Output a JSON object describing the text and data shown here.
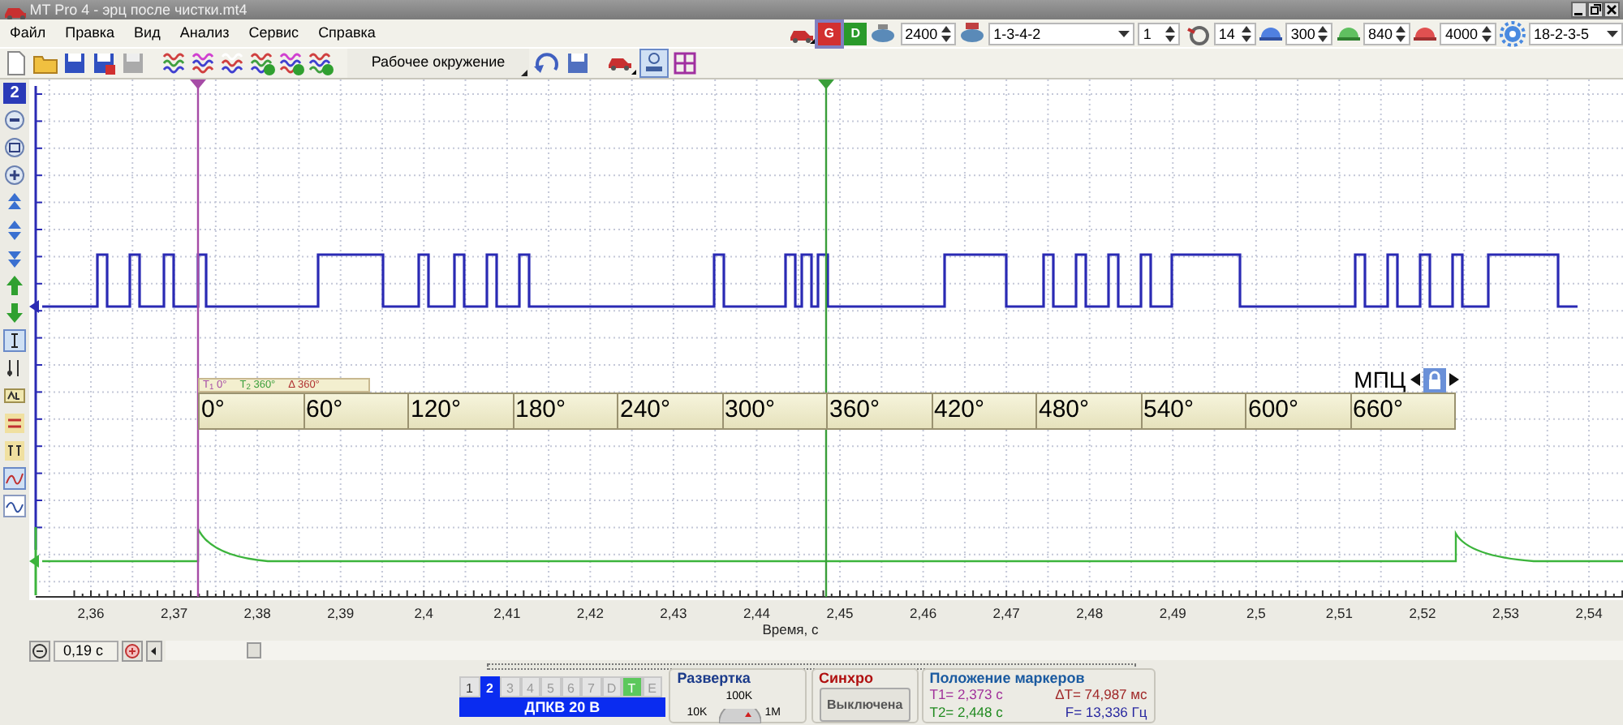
{
  "window": {
    "title": "MT Pro 4 - эрц после чистки.mt4"
  },
  "menu": [
    "Файл",
    "Правка",
    "Вид",
    "Анализ",
    "Сервис",
    "Справка"
  ],
  "engine_bar": {
    "modes": [
      {
        "label": "G",
        "selected": true
      },
      {
        "label": "D",
        "selected": false
      }
    ],
    "fields": [
      {
        "kind": "spin",
        "value": "2400"
      },
      {
        "kind": "combo",
        "value": "1-3-4-2"
      },
      {
        "kind": "spin",
        "value": "1"
      },
      {
        "kind": "spin",
        "value": "14"
      },
      {
        "kind": "spin",
        "value": "300"
      },
      {
        "kind": "spin",
        "value": "840"
      },
      {
        "kind": "spin",
        "value": "4000"
      },
      {
        "kind": "combo",
        "value": "18-2-3-5"
      }
    ]
  },
  "toolbar": {
    "workspace_button": "Рабочее окружение"
  },
  "plot": {
    "channel": "2",
    "traces": [
      {
        "color": "#2a2ab4"
      },
      {
        "color": "#3cb43c"
      }
    ],
    "markers": [
      {
        "color": "#a64ca6"
      },
      {
        "color": "#3a9e3a"
      }
    ],
    "x_ticks": [
      "2,36",
      "2,37",
      "2,38",
      "2,39",
      "2,4",
      "2,41",
      "2,42",
      "2,43",
      "2,44",
      "2,45",
      "2,46",
      "2,47",
      "2,48",
      "2,49",
      "2,5",
      "2,51",
      "2,52",
      "2,53",
      "2,54"
    ],
    "x_label": "Время, с"
  },
  "phase_scale": {
    "readouts": [
      {
        "text": "T$_{1}$ 0°",
        "color": "#a64ca6"
      },
      {
        "text": "T$_{2}$ 360°",
        "color": "#3a9e3a"
      },
      {
        "text": "Δ 360°",
        "color": "#b03030"
      }
    ],
    "title": "МПЦ",
    "ticks": [
      "0°",
      "60°",
      "120°",
      "180°",
      "240°",
      "300°",
      "360°",
      "420°",
      "480°",
      "540°",
      "600°",
      "660°"
    ]
  },
  "time_window": "0,19 с",
  "bottom": {
    "channel_tabs": [
      {
        "label": "1",
        "selected": false,
        "disabled": false,
        "color": "#e4e4e4"
      },
      {
        "label": "2",
        "selected": true,
        "disabled": false,
        "color": "#0a2cf0"
      },
      {
        "label": "3",
        "selected": false,
        "disabled": true,
        "color": "#e4e4e4"
      },
      {
        "label": "4",
        "selected": false,
        "disabled": true,
        "color": "#e4e4e4"
      },
      {
        "label": "5",
        "selected": false,
        "disabled": true,
        "color": "#e4e4e4"
      },
      {
        "label": "6",
        "selected": false,
        "disabled": true,
        "color": "#e4e4e4"
      },
      {
        "label": "7",
        "selected": false,
        "disabled": true,
        "color": "#e4e4e4"
      },
      {
        "label": "D",
        "selected": false,
        "disabled": true,
        "color": "#e4e4e4"
      },
      {
        "label": "T",
        "selected": false,
        "disabled": false,
        "color": "#5cc85c"
      },
      {
        "label": "E",
        "selected": false,
        "disabled": true,
        "color": "#e4e4e4"
      }
    ],
    "channel_name": "ДПКВ 20 В",
    "sweep": {
      "title": "Развертка",
      "dial_labels": [
        "100K",
        "10K",
        "1M"
      ]
    },
    "sync": {
      "title": "Синхро",
      "button": "Выключена"
    },
    "marker_positions": {
      "title": "Положение маркеров",
      "readouts": [
        {
          "text": "T1= 2,373 с",
          "color": "#a0309a"
        },
        {
          "text": "ΔT= 74,987 мс",
          "color": "#a02828"
        },
        {
          "text": "T2= 2,448 с",
          "color": "#208a20"
        },
        {
          "text": "F= 13,336 Гц",
          "color": "#2828a0"
        }
      ]
    }
  }
}
